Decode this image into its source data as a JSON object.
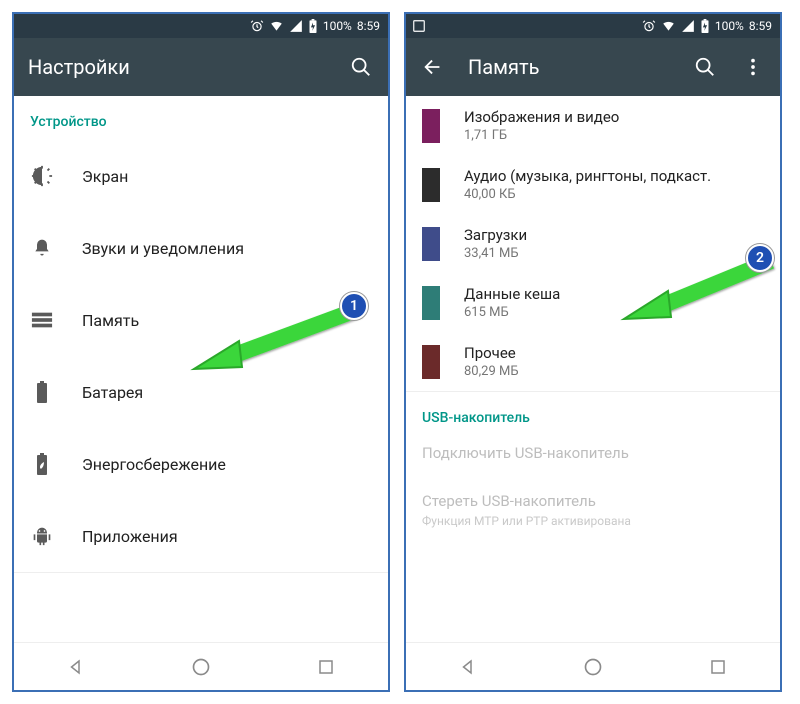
{
  "status": {
    "battery": "100%",
    "time": "8:59"
  },
  "left": {
    "title": "Настройки",
    "section": "Устройство",
    "items": [
      {
        "name": "display",
        "label": "Экран"
      },
      {
        "name": "sound",
        "label": "Звуки и уведомления"
      },
      {
        "name": "storage",
        "label": "Память"
      },
      {
        "name": "battery",
        "label": "Батарея"
      },
      {
        "name": "power",
        "label": "Энергосбережение"
      },
      {
        "name": "apps",
        "label": "Приложения"
      }
    ]
  },
  "right": {
    "title": "Память",
    "categories": [
      {
        "name": "images",
        "label": "Изображения и видео",
        "value": "1,71 ГБ",
        "color": "#7b1f5e"
      },
      {
        "name": "audio",
        "label": "Аудио (музыка, рингтоны, подкаст.",
        "value": "40,00 КБ",
        "color": "#2c2c2c"
      },
      {
        "name": "downloads",
        "label": "Загрузки",
        "value": "33,41 МБ",
        "color": "#3f4c8a"
      },
      {
        "name": "cache",
        "label": "Данные кеша",
        "value": "615 МБ",
        "color": "#2e7d77"
      },
      {
        "name": "other",
        "label": "Прочее",
        "value": "80,29 МБ",
        "color": "#6b2a2a"
      }
    ],
    "usb": {
      "header": "USB-накопитель",
      "mount": "Подключить USB-накопитель",
      "erase": "Стереть USB-накопитель",
      "note": "Функция MTP или PTP активирована"
    }
  },
  "annotations": {
    "badge1": "1",
    "badge2": "2"
  }
}
